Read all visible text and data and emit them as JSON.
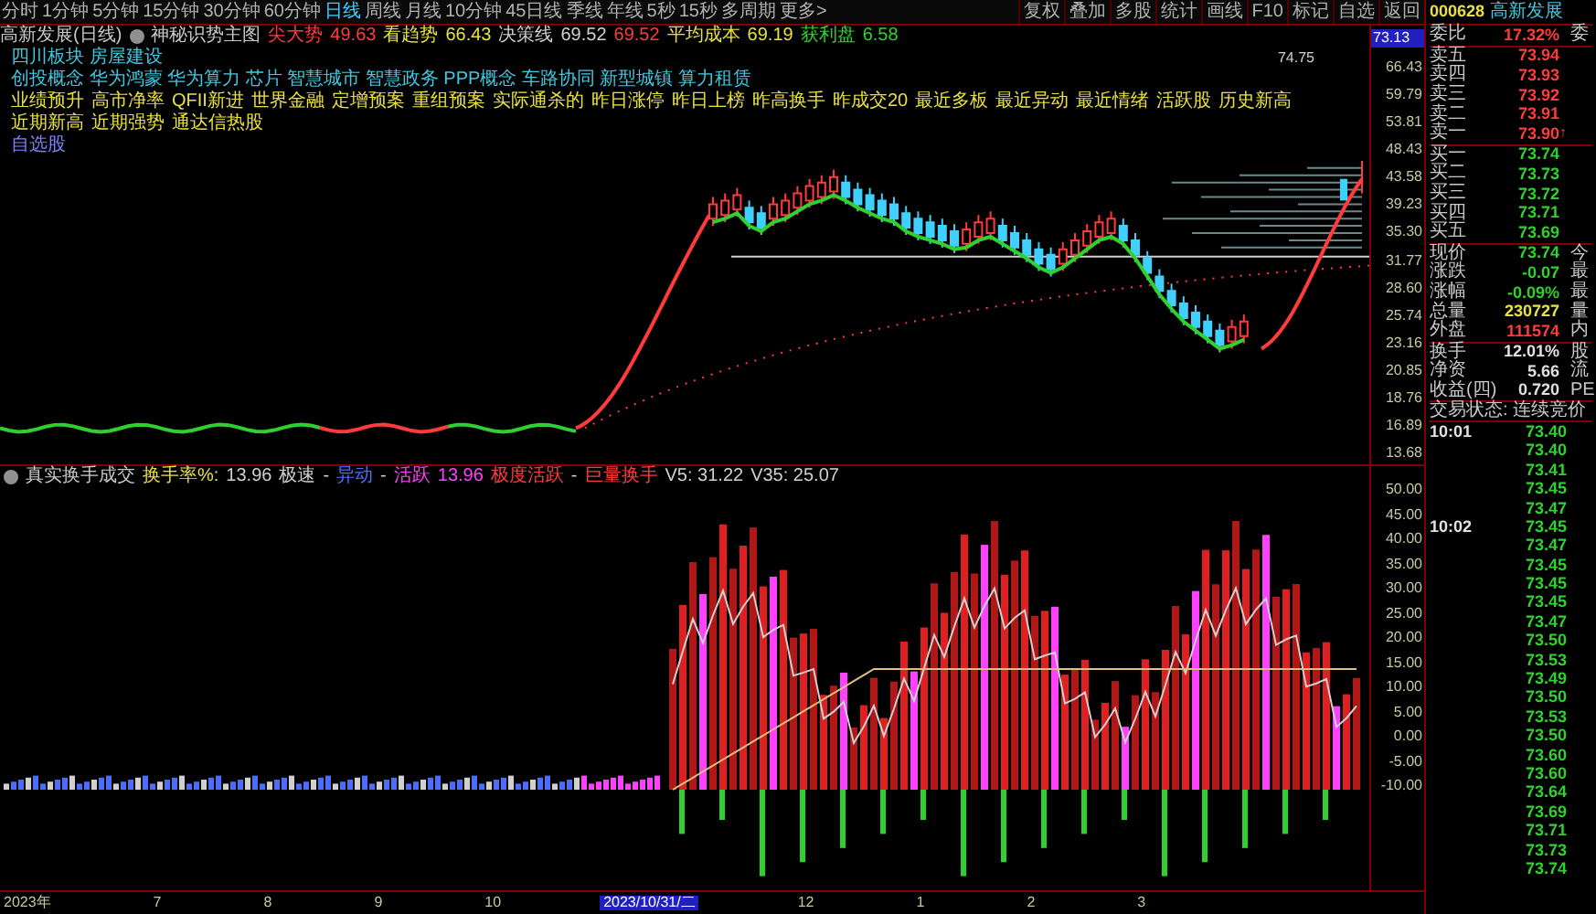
{
  "toolbar": {
    "periods": [
      {
        "label": "分时",
        "selected": false
      },
      {
        "label": "1分钟",
        "selected": false
      },
      {
        "label": "5分钟",
        "selected": false
      },
      {
        "label": "15分钟",
        "selected": false
      },
      {
        "label": "30分钟",
        "selected": false
      },
      {
        "label": "60分钟",
        "selected": false
      },
      {
        "label": "日线",
        "selected": true
      },
      {
        "label": "周线",
        "selected": false
      },
      {
        "label": "月线",
        "selected": false
      },
      {
        "label": "10分钟",
        "selected": false
      },
      {
        "label": "45日线",
        "selected": false
      },
      {
        "label": "季线",
        "selected": false
      },
      {
        "label": "年线",
        "selected": false
      },
      {
        "label": "5秒",
        "selected": false
      },
      {
        "label": "15秒",
        "selected": false
      },
      {
        "label": "多周期",
        "selected": false
      },
      {
        "label": "更多>",
        "selected": false
      }
    ],
    "actions": [
      "复权",
      "叠加",
      "多股",
      "统计",
      "画线",
      "F10",
      "标记",
      "自选",
      "返回"
    ]
  },
  "chart_header": {
    "title": "高新发展(日线)",
    "indicator": "神秘识势主图",
    "readings": [
      {
        "label": "尖大势",
        "value": "49.63",
        "color": "#ff3b3b"
      },
      {
        "label": "看趋势",
        "value": "66.43",
        "color": "#e8e040"
      },
      {
        "label": "决策线",
        "value": "69.52",
        "color": "#d0d0d0"
      },
      {
        "value": "69.52",
        "color": "#ff3b3b"
      },
      {
        "label": "平均成本",
        "value": "69.19",
        "color": "#e8e040"
      },
      {
        "label": "获利盘",
        "value": "6.58",
        "color": "#30d030"
      }
    ]
  },
  "sector": "四川板块 房屋建设",
  "concepts": "创投概念 华为鸿蒙 华为算力 芯片 智慧城市 智慧政务 PPP概念 车路协同 新型城镇 算力租赁",
  "tags": [
    "业绩预升",
    "高市净率",
    "QFII新进",
    "世界金融",
    "定增预案",
    "重组预案",
    "实际通杀的",
    "昨日涨停",
    "昨日上榜",
    "昨高换手",
    "昨成交20",
    "最近多板",
    "最近异动",
    "最近情绪",
    "活跃股",
    "历史新高",
    "近期新高",
    "近期强势",
    "通达信热股"
  ],
  "watchlist": "自选股",
  "price_marker": "74.75",
  "price_axis": {
    "current": "73.13",
    "ticks": [
      "66.43",
      "59.79",
      "53.81",
      "48.43",
      "43.58",
      "39.23",
      "35.30",
      "31.77",
      "28.60",
      "25.74",
      "23.16",
      "20.85",
      "18.76",
      "16.89",
      "13.68"
    ]
  },
  "indicator": {
    "title": "真实换手成交",
    "segments": [
      {
        "text": "换手率%:",
        "color": "#e8e040"
      },
      {
        "text": "13.96",
        "color": "#d0d0d0"
      },
      {
        "text": "极速",
        "color": "#d0d0d0"
      },
      {
        "text": "-",
        "color": "#d0d0d0"
      },
      {
        "text": "异动",
        "color": "#4a6cff"
      },
      {
        "text": "-",
        "color": "#d0d0d0"
      },
      {
        "text": "活跃",
        "color": "#ff40ff"
      },
      {
        "text": "13.96",
        "color": "#ff40ff"
      },
      {
        "text": "极度活跃",
        "color": "#ff3b3b"
      },
      {
        "text": "-",
        "color": "#d0d0d0"
      },
      {
        "text": "巨量换手",
        "color": "#ff3b3b"
      },
      {
        "text": "V5: 31.22",
        "color": "#d0d0d0"
      },
      {
        "text": "V35: 25.07",
        "color": "#d0d0d0"
      }
    ]
  },
  "indicator_axis": [
    "50.00",
    "45.00",
    "40.00",
    "35.00",
    "30.00",
    "25.00",
    "20.00",
    "15.00",
    "10.00",
    "5.00",
    "0.00",
    "-5.00",
    "-10.00"
  ],
  "time_axis": [
    {
      "label": "2023年",
      "selected": false
    },
    {
      "label": "7",
      "selected": false
    },
    {
      "label": "8",
      "selected": false
    },
    {
      "label": "9",
      "selected": false
    },
    {
      "label": "10",
      "selected": false
    },
    {
      "label": "2023/10/31/二",
      "selected": true
    },
    {
      "label": "12",
      "selected": false
    },
    {
      "label": "1",
      "selected": false
    },
    {
      "label": "2",
      "selected": false
    },
    {
      "label": "3",
      "selected": false
    }
  ],
  "quote": {
    "code": "000628",
    "name": "高新发展",
    "ratio": {
      "label": "委比",
      "value": "17.32%",
      "extra": "委"
    },
    "asks": [
      {
        "label": "卖五",
        "value": "73.94"
      },
      {
        "label": "卖四",
        "value": "73.93"
      },
      {
        "label": "卖三",
        "value": "73.92"
      },
      {
        "label": "卖二",
        "value": "73.91"
      },
      {
        "label": "卖一",
        "value": "73.90",
        "flag": "↑"
      }
    ],
    "bids": [
      {
        "label": "买一",
        "value": "73.74"
      },
      {
        "label": "买二",
        "value": "73.73"
      },
      {
        "label": "买三",
        "value": "73.72"
      },
      {
        "label": "买四",
        "value": "73.71"
      },
      {
        "label": "买五",
        "value": "73.69"
      }
    ],
    "stats": [
      {
        "label": "现价",
        "value": "73.74",
        "color": "#30d030",
        "extra": "今"
      },
      {
        "label": "涨跌",
        "value": "-0.07",
        "color": "#30d030",
        "extra": "最"
      },
      {
        "label": "涨幅",
        "value": "-0.09%",
        "color": "#30d030",
        "extra": "最"
      },
      {
        "label": "总量",
        "value": "230727",
        "color": "#e8e040",
        "extra": "量"
      },
      {
        "label": "外盘",
        "value": "111574",
        "color": "#ff3b3b",
        "extra": "内"
      }
    ],
    "stats2": [
      {
        "label": "换手",
        "value": "12.01%",
        "extra": "股"
      },
      {
        "label": "净资",
        "value": "5.66",
        "extra": "流"
      },
      {
        "label": "收益(四)",
        "value": "0.720",
        "extra": "PE"
      }
    ],
    "status": "交易状态: 连续竞价",
    "ticks": [
      {
        "time": "10:01",
        "price": "73.40"
      },
      {
        "price": "73.40"
      },
      {
        "price": "73.41"
      },
      {
        "price": "73.45"
      },
      {
        "price": "73.47"
      },
      {
        "time": "10:02",
        "price": "73.45"
      },
      {
        "price": "73.47"
      },
      {
        "price": "73.45"
      },
      {
        "price": "73.45"
      },
      {
        "price": "73.45"
      },
      {
        "price": "73.47"
      },
      {
        "price": "73.50"
      },
      {
        "price": "73.53"
      },
      {
        "price": "73.49"
      },
      {
        "price": "73.50"
      },
      {
        "price": "73.53"
      },
      {
        "price": "73.50"
      },
      {
        "price": "73.60"
      },
      {
        "price": "73.60"
      },
      {
        "price": "73.64"
      },
      {
        "price": "73.69"
      },
      {
        "price": "73.71"
      },
      {
        "price": "73.73"
      },
      {
        "price": "73.74"
      }
    ]
  }
}
